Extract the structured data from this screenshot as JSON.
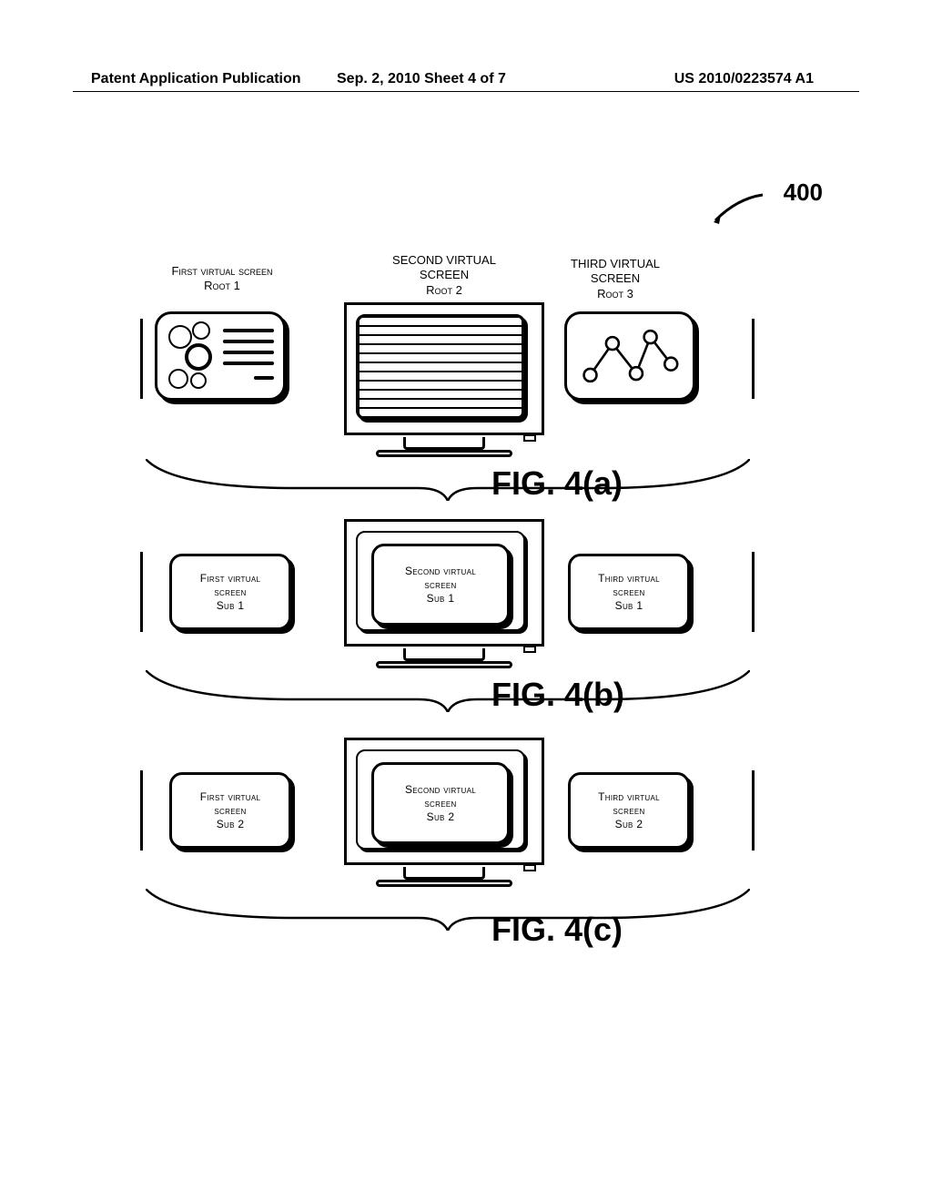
{
  "header": {
    "left": "Patent Application Publication",
    "mid": "Sep. 2, 2010   Sheet 4 of 7",
    "right": "US 2010/0223574 A1"
  },
  "ref": {
    "num": "400"
  },
  "rowA": {
    "left_title": "First virtual screen\nRoot 1",
    "mid_title": "SECOND VIRTUAL\nSCREEN\nRoot 2",
    "right_title": "THIRD VIRTUAL\nSCREEN\nRoot 3",
    "fig": "FIG. 4(a)"
  },
  "rowB": {
    "left_box": "First virtual\nscreen\nSub 1",
    "mid_box": "Second virtual\nscreen\nSub 1",
    "right_box": "Third virtual\nscreen\nSub 1",
    "fig": "FIG. 4(b)"
  },
  "rowC": {
    "left_box": "First virtual\nscreen\nSub 2",
    "mid_box": "Second virtual\nscreen\nSub 2",
    "right_box": "Third virtual\nscreen\nSub 2",
    "fig": "FIG. 4(c)"
  }
}
